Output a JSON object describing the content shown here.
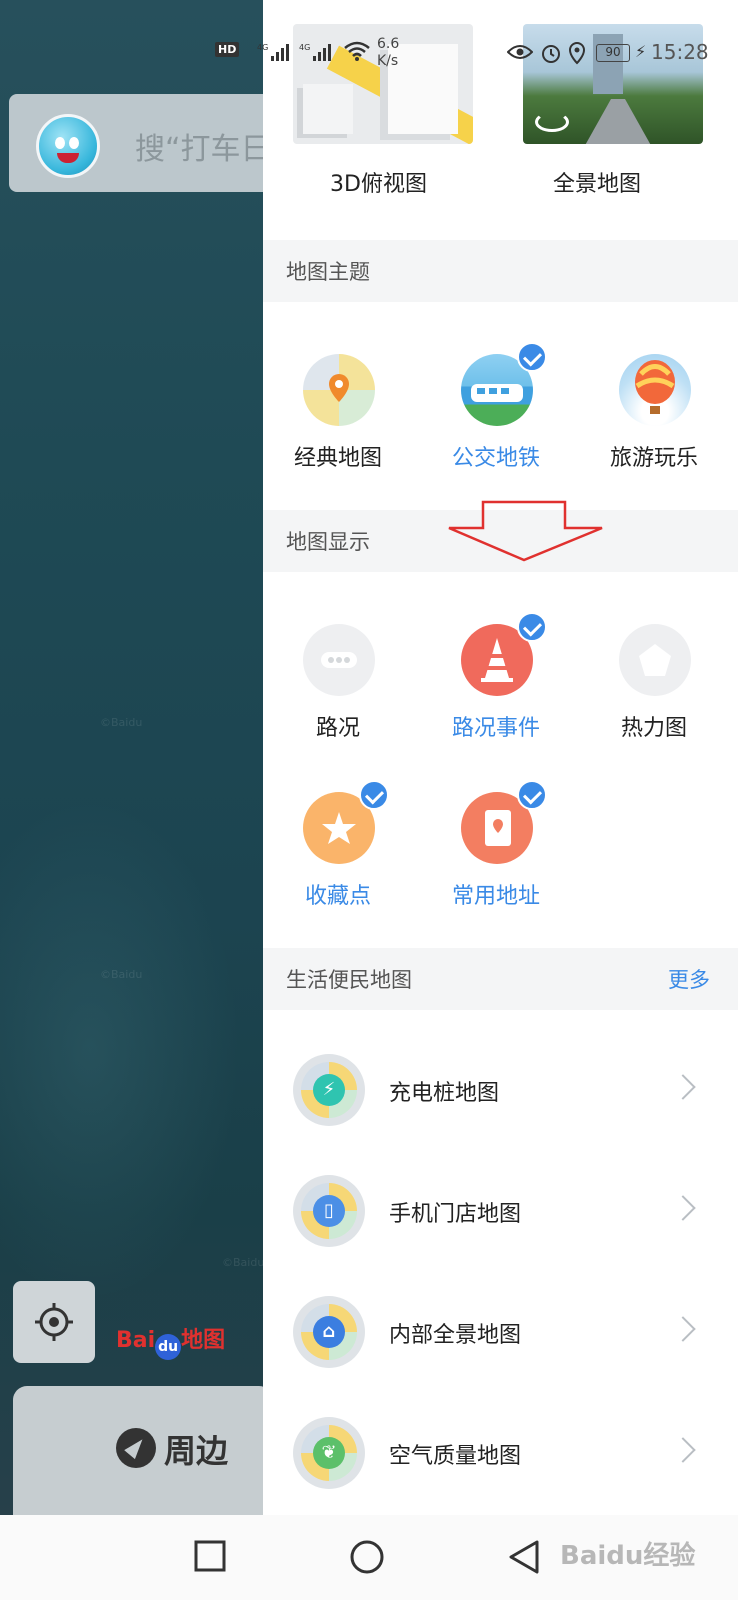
{
  "background_map": {
    "search_placeholder": "搜“打车日",
    "logo_text": "Bai",
    "logo_paw": "du",
    "logo_suffix": "地图",
    "nearby_label": "周边",
    "watermarks": [
      "©Baidu",
      "©Baidu",
      "©Baidu"
    ]
  },
  "status_bar": {
    "hd": "HD",
    "network": "4G",
    "speed_value": "6.6",
    "speed_unit": "K/s",
    "battery": "90",
    "time": "15:28"
  },
  "view_modes": [
    {
      "label": "3D俯视图"
    },
    {
      "label": "全景地图"
    }
  ],
  "map_theme": {
    "title": "地图主题",
    "items": [
      {
        "label": "经典地图",
        "checked": false
      },
      {
        "label": "公交地铁",
        "checked": true
      },
      {
        "label": "旅游玩乐",
        "checked": false
      }
    ]
  },
  "map_display": {
    "title": "地图显示",
    "items": [
      {
        "label": "路况",
        "checked": false
      },
      {
        "label": "路况事件",
        "checked": true
      },
      {
        "label": "热力图",
        "checked": false
      },
      {
        "label": "收藏点",
        "checked": true
      },
      {
        "label": "常用地址",
        "checked": true
      }
    ]
  },
  "life_maps": {
    "title": "生活便民地图",
    "more": "更多",
    "items": [
      {
        "label": "充电桩地图",
        "icon": "charging-icon"
      },
      {
        "label": "手机门店地图",
        "icon": "phone-store-icon"
      },
      {
        "label": "内部全景地图",
        "icon": "indoor-panorama-icon"
      },
      {
        "label": "空气质量地图",
        "icon": "air-quality-icon"
      }
    ]
  },
  "nav_watermark": "Baidu经验",
  "colors": {
    "accent": "#3a8ae6",
    "section_bg": "#f4f5f6",
    "annotation_arrow": "#e0312f"
  }
}
